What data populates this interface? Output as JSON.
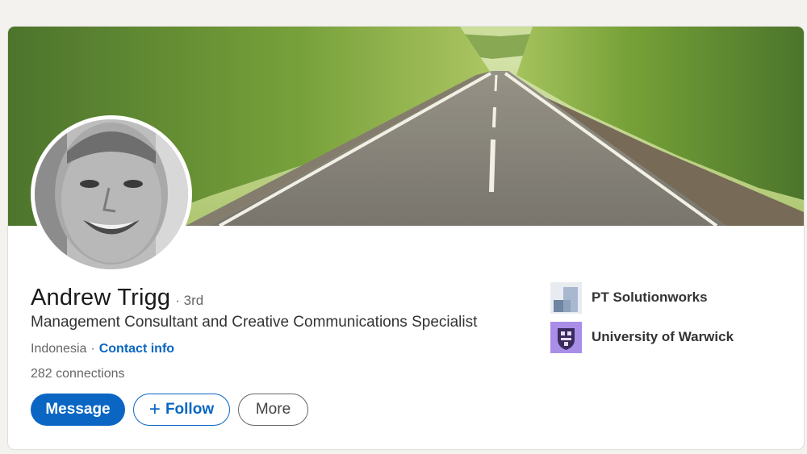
{
  "profile": {
    "name": "Andrew Trigg",
    "degree": "3rd",
    "degree_separator": "·",
    "headline": "Management Consultant and Creative Communications Specialist",
    "location": "Indonesia",
    "location_separator": "·",
    "contact_info_label": "Contact info",
    "connections": "282 connections"
  },
  "actions": {
    "message_label": "Message",
    "follow_label": "Follow",
    "follow_icon": "+",
    "more_label": "More"
  },
  "organizations": [
    {
      "name": "PT Solutionworks",
      "logo_icon": "company-logo-icon"
    },
    {
      "name": "University of Warwick",
      "logo_icon": "university-crest-icon"
    }
  ],
  "colors": {
    "brand_blue": "#0a66c2",
    "page_background": "#f3f2ef",
    "card_background": "#ffffff",
    "secondary_text": "#666666"
  },
  "banner": {
    "icon": "road-landscape-banner"
  },
  "avatar": {
    "icon": "profile-photo"
  }
}
